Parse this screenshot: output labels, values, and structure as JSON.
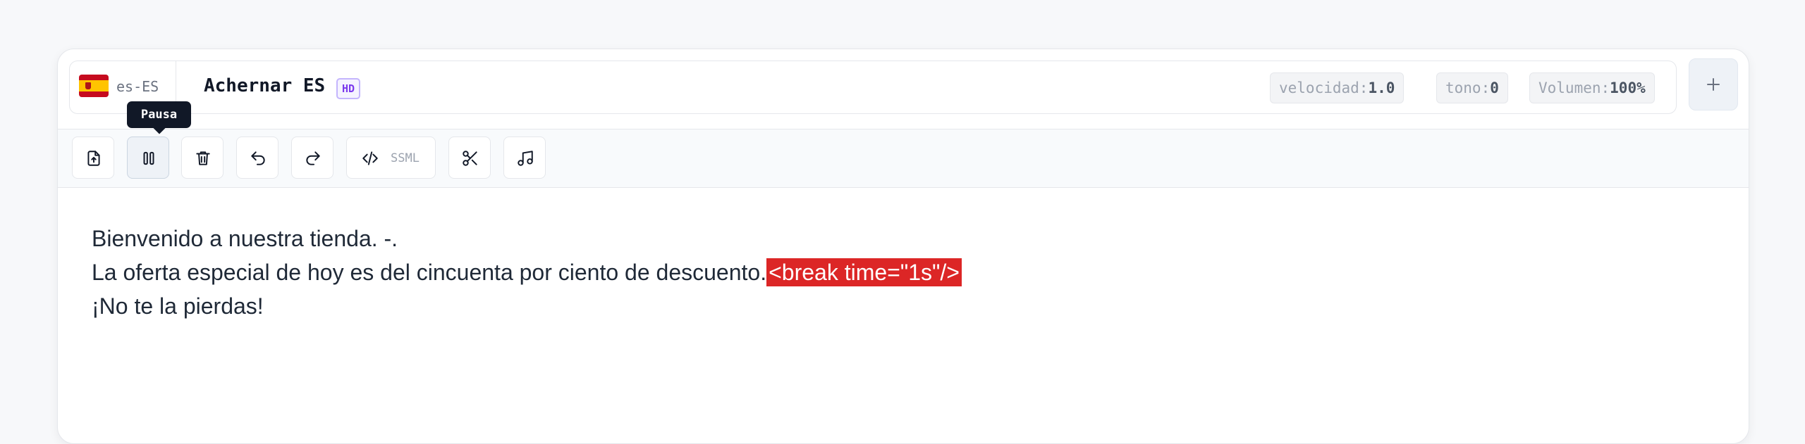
{
  "header": {
    "locale_code": "es-ES",
    "voice_name": "Achernar ES",
    "quality_badge": "HD",
    "params": {
      "speed": {
        "label": "velocidad:",
        "value": "1.0"
      },
      "pitch": {
        "label": "tono:",
        "value": "0"
      },
      "volume": {
        "label": "Volumen:",
        "value": "100%"
      }
    }
  },
  "toolbar": {
    "ssml_label": "SSML",
    "tooltip": "Pausa",
    "icons": [
      "file-upload-icon",
      "pause-icon",
      "trash-icon",
      "undo-icon",
      "redo-icon",
      "code-icon",
      "scissors-icon",
      "music-note-icon"
    ]
  },
  "editor": {
    "line1": "Bienvenido a nuestra tienda. -.",
    "line2_text": "La oferta especial de hoy es del cincuenta por ciento de descuento.",
    "line2_tag": "<break time=\"1s\"/>",
    "line3": "¡No te la pierdas!"
  },
  "colors": {
    "break_tag_bg": "#dc2626",
    "badge_accent": "#7c3aed",
    "text": "#1f2937"
  }
}
